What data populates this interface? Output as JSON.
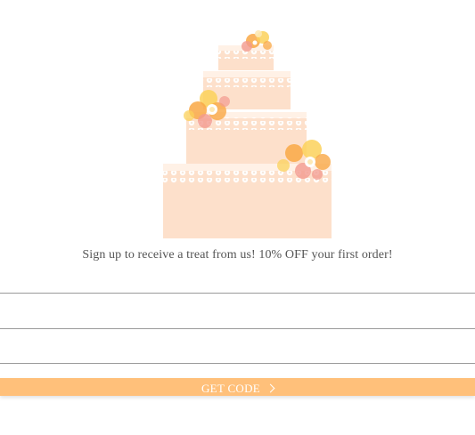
{
  "illustration": {
    "name": "wedding-cake-illustration",
    "colors": {
      "cake_body": "#fde0cb",
      "cake_top": "#fff1e6",
      "lace": "#ffffff",
      "flower_orange": "#f9a845",
      "flower_yellow": "#fbd15b",
      "flower_pink": "#f29a8e"
    }
  },
  "signup": {
    "tagline": "Sign up to receive a treat from us! 10% OFF your first order!",
    "fields": [
      {
        "value": "",
        "placeholder": ""
      },
      {
        "value": "",
        "placeholder": ""
      },
      {
        "value": "",
        "placeholder": ""
      }
    ],
    "submit_label": "GET CODE",
    "submit_icon": "chevron-right-icon",
    "accent_color": "#ffc07a"
  }
}
